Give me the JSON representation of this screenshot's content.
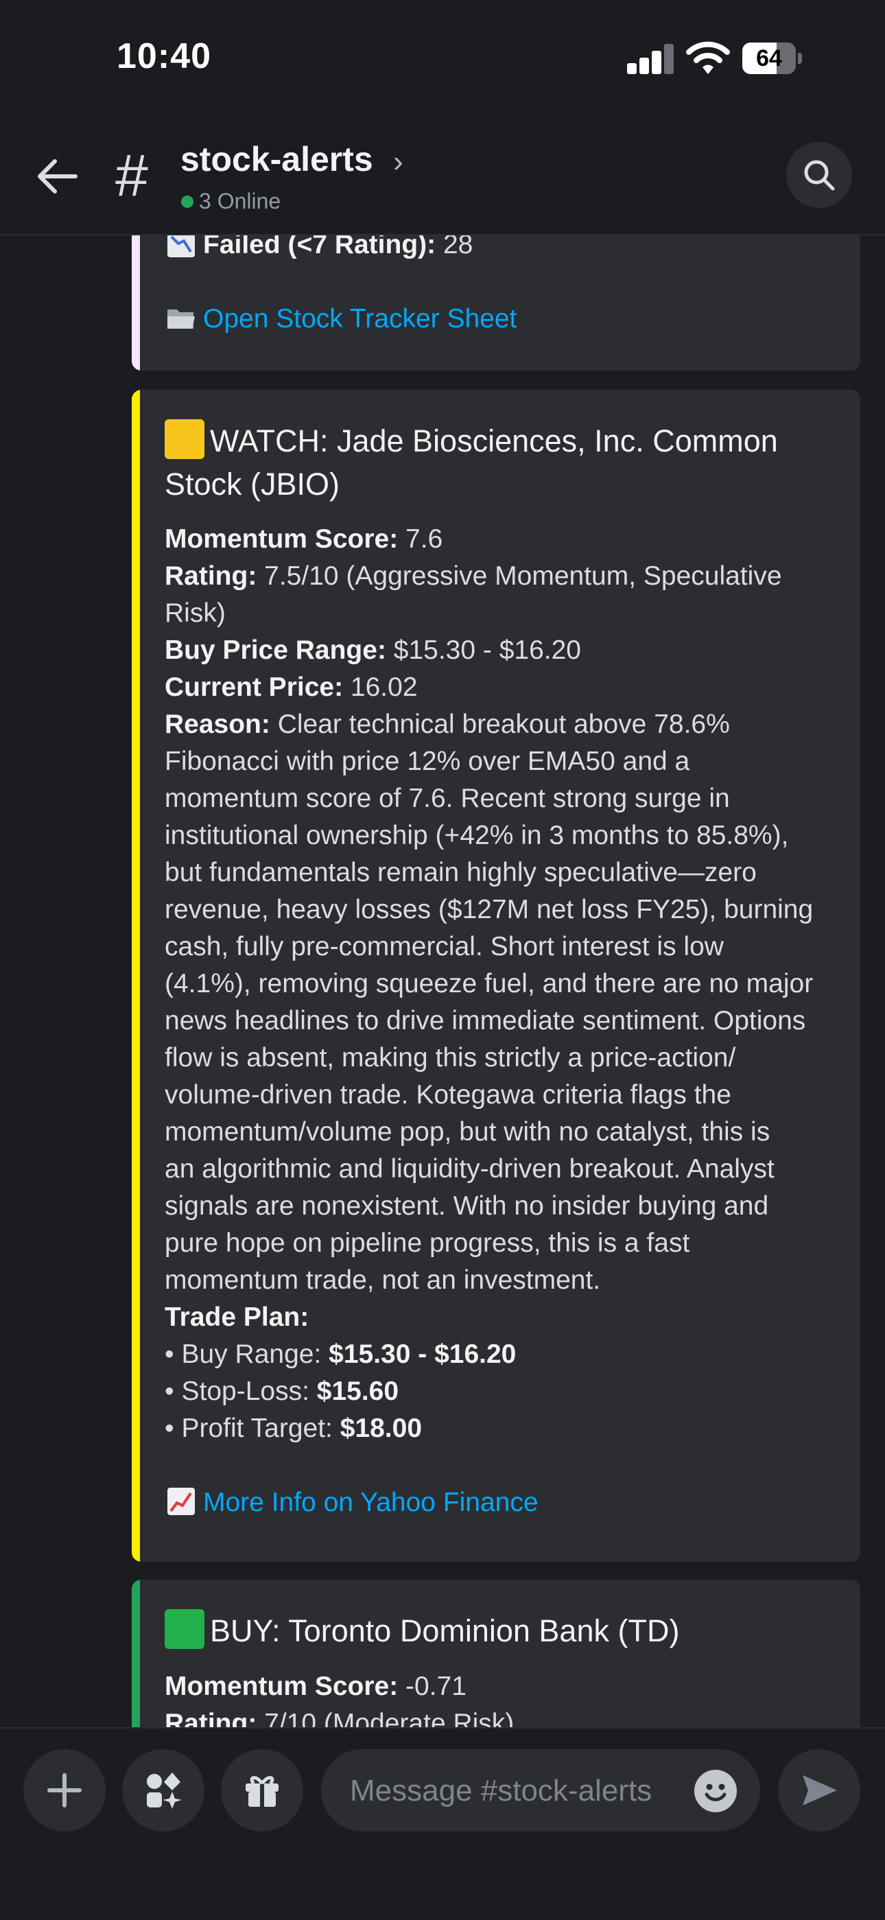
{
  "status_bar": {
    "time": "10:40",
    "battery": "64",
    "battery_level": 0.64
  },
  "header": {
    "channel": "stock-alerts",
    "chevron": "›",
    "online": "3 Online"
  },
  "prev_embed": {
    "failed_label": "Failed (<7 Rating):",
    "failed_value": " 28",
    "sheet_link": "Open Stock Tracker Sheet",
    "accent": "#f5e6ff"
  },
  "embed_watch": {
    "accent": "#ffee00",
    "title_l1": "WATCH: Jade Biosciences, Inc. Common",
    "title_l2": "Stock (JBIO)",
    "momentum_label": "Momentum Score:",
    "momentum_value": " 7.6",
    "rating_label": "Rating:",
    "rating_value_l1": " 7.5/10 (Aggressive Momentum, Speculative",
    "rating_value_l2": "Risk)",
    "buy_label": "Buy Price Range:",
    "buy_value": " $15.30 - $16.20",
    "current_label": "Current Price:",
    "current_value": " 16.02",
    "reason_label": "Reason:",
    "reason_lines": [
      " Clear technical breakout above 78.6%",
      "Fibonacci with price 12% over EMA50 and a",
      "momentum score of 7.6. Recent strong surge in",
      "institutional ownership (+42% in 3 months to 85.8%),",
      "but fundamentals remain highly speculative—zero",
      "revenue, heavy losses ($127M net loss FY25), burning",
      "cash, fully pre-commercial. Short interest is low",
      "(4.1%), removing squeeze fuel, and there are no major",
      "news headlines to drive immediate sentiment. Options",
      "flow is absent, making this strictly a price-action/",
      "volume-driven trade. Kotegawa criteria flags the",
      "momentum/volume pop, but with no catalyst, this is",
      "an algorithmic and liquidity-driven breakout. Analyst",
      "signals are nonexistent. With no insider buying and",
      "pure hope on pipeline progress, this is a fast",
      "momentum trade, not an investment."
    ],
    "trade_plan_label": "Trade Plan:",
    "plan_buy_label": "• Buy Range: ",
    "plan_buy_value": "$15.30 - $16.20",
    "plan_stop_label": "• Stop-Loss: ",
    "plan_stop_value": "$15.60",
    "plan_target_label": "• Profit Target: ",
    "plan_target_value": "$18.00",
    "link": "More Info on Yahoo Finance"
  },
  "embed_buy": {
    "accent": "#23a55a",
    "title": "BUY: Toronto Dominion Bank (TD)",
    "momentum_label": "Momentum Score:",
    "momentum_value": " -0.71",
    "rating_label": "Rating:",
    "rating_value": " 7/10 (Moderate Risk)"
  },
  "composer": {
    "placeholder": "Message #stock-alerts"
  }
}
